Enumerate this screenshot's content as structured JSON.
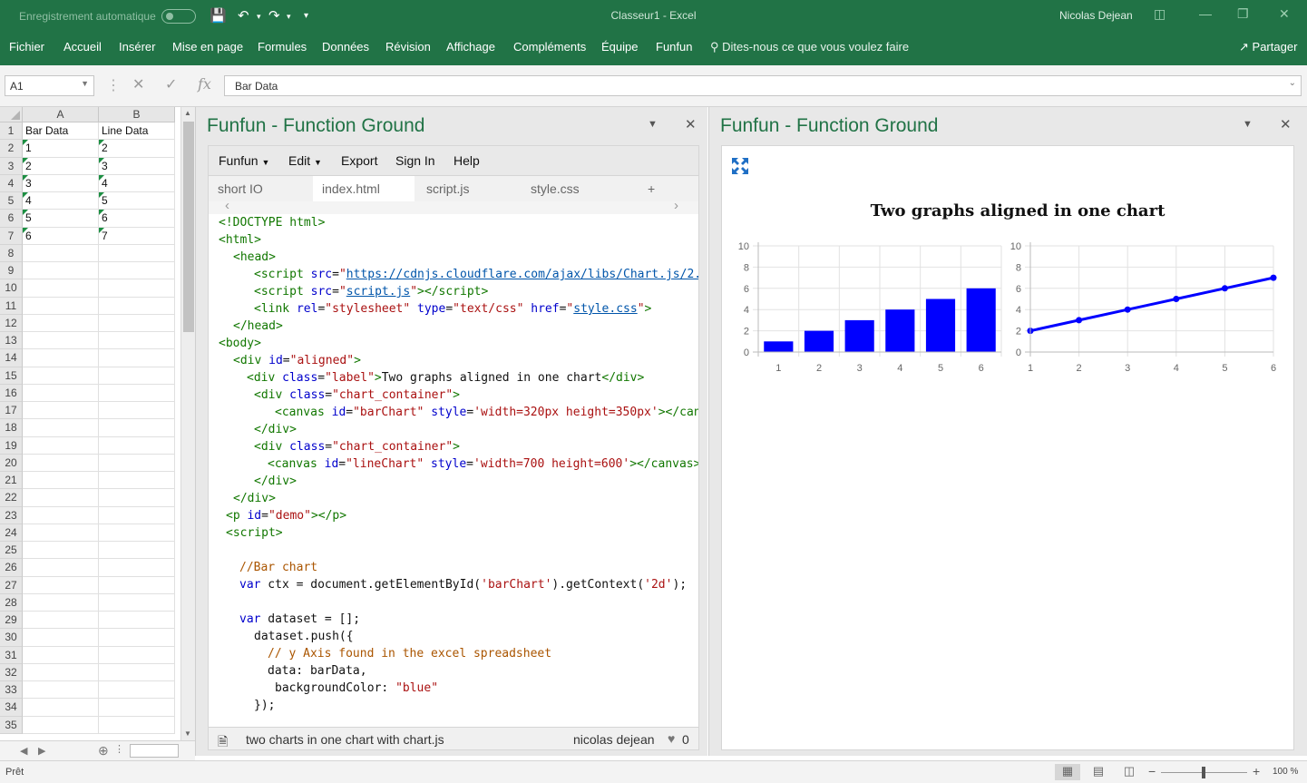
{
  "titlebar": {
    "autosave": "Enregistrement automatique",
    "document": "Classeur1 - Excel",
    "user": "Nicolas Dejean"
  },
  "ribbon": {
    "tabs": [
      "Fichier",
      "Accueil",
      "Insérer",
      "Mise en page",
      "Formules",
      "Données",
      "Révision",
      "Affichage",
      "Compléments",
      "Équipe",
      "Funfun"
    ],
    "tell_me": "Dites-nous ce que vous voulez faire",
    "share": "Partager"
  },
  "formula_bar": {
    "name_box": "A1",
    "content": "Bar Data"
  },
  "sheet": {
    "columns": [
      "A",
      "B"
    ],
    "rows": [
      [
        "Bar Data",
        "Line Data"
      ],
      [
        "1",
        "2"
      ],
      [
        "2",
        "3"
      ],
      [
        "3",
        "4"
      ],
      [
        "4",
        "5"
      ],
      [
        "5",
        "6"
      ],
      [
        "6",
        "7"
      ]
    ],
    "row_count": 35
  },
  "statusbar": {
    "ready": "Prêt",
    "zoom": "100 %"
  },
  "editor_pane": {
    "title": "Funfun - Function Ground",
    "menu": [
      "Funfun",
      "Edit",
      "Export",
      "Sign In",
      "Help"
    ],
    "tabs": [
      "short IO",
      "index.html",
      "script.js",
      "style.css",
      "+"
    ],
    "footer_title": "two charts in one chart with chart.js",
    "footer_author": "nicolas dejean",
    "likes": "0"
  },
  "preview_pane": {
    "title": "Funfun - Function Ground"
  },
  "chart_data": [
    {
      "type": "bar",
      "title": "Two graphs aligned in one chart",
      "categories": [
        "1",
        "2",
        "3",
        "4",
        "5",
        "6"
      ],
      "values": [
        1,
        2,
        3,
        4,
        5,
        6
      ],
      "ylim": [
        0,
        10
      ],
      "yticks": [
        0,
        2,
        4,
        6,
        8,
        10
      ],
      "color": "#0000ff",
      "grid": true
    },
    {
      "type": "line",
      "categories": [
        "1",
        "2",
        "3",
        "4",
        "5",
        "6"
      ],
      "values": [
        2,
        3,
        4,
        5,
        6,
        7
      ],
      "ylim": [
        0,
        10
      ],
      "yticks": [
        0,
        2,
        4,
        6,
        8,
        10
      ],
      "color": "#0000ff",
      "grid": true
    }
  ]
}
